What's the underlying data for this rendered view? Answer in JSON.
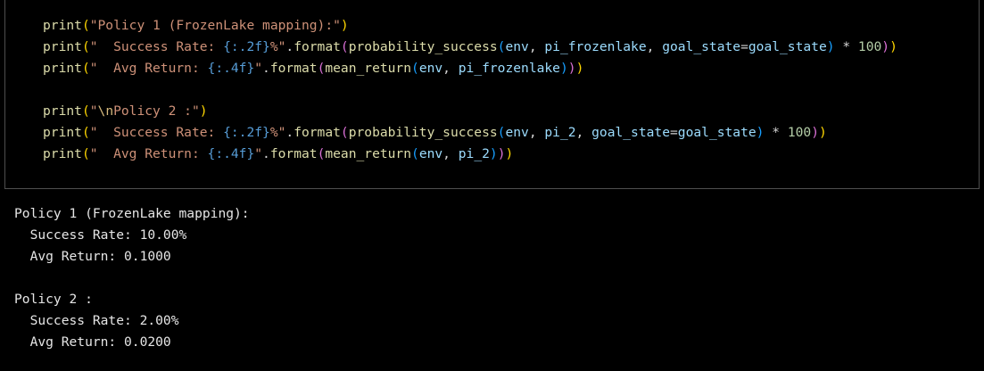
{
  "code": {
    "lines": [
      {
        "tokens": [
          {
            "text": "print",
            "cls": "fn"
          },
          {
            "text": "(",
            "cls": "p1"
          },
          {
            "text": "\"Policy 1 (FrozenLake mapping):\"",
            "cls": "str"
          },
          {
            "text": ")",
            "cls": "p1"
          }
        ]
      },
      {
        "tokens": [
          {
            "text": "print",
            "cls": "fn"
          },
          {
            "text": "(",
            "cls": "p1"
          },
          {
            "text": "\"  Success Rate: ",
            "cls": "str"
          },
          {
            "text": "{:.2f}",
            "cls": "fmt"
          },
          {
            "text": "%\"",
            "cls": "str"
          },
          {
            "text": ".",
            "cls": "op"
          },
          {
            "text": "format",
            "cls": "fn"
          },
          {
            "text": "(",
            "cls": "p2"
          },
          {
            "text": "probability_success",
            "cls": "fn"
          },
          {
            "text": "(",
            "cls": "p3"
          },
          {
            "text": "env",
            "cls": "var"
          },
          {
            "text": ", ",
            "cls": "op"
          },
          {
            "text": "pi_frozenlake",
            "cls": "var"
          },
          {
            "text": ", ",
            "cls": "op"
          },
          {
            "text": "goal_state",
            "cls": "var"
          },
          {
            "text": "=",
            "cls": "op"
          },
          {
            "text": "goal_state",
            "cls": "var"
          },
          {
            "text": ")",
            "cls": "p3"
          },
          {
            "text": " * ",
            "cls": "op"
          },
          {
            "text": "100",
            "cls": "num"
          },
          {
            "text": ")",
            "cls": "p2"
          },
          {
            "text": ")",
            "cls": "p1"
          }
        ]
      },
      {
        "tokens": [
          {
            "text": "print",
            "cls": "fn"
          },
          {
            "text": "(",
            "cls": "p1"
          },
          {
            "text": "\"  Avg Return: ",
            "cls": "str"
          },
          {
            "text": "{:.4f}",
            "cls": "fmt"
          },
          {
            "text": "\"",
            "cls": "str"
          },
          {
            "text": ".",
            "cls": "op"
          },
          {
            "text": "format",
            "cls": "fn"
          },
          {
            "text": "(",
            "cls": "p2"
          },
          {
            "text": "mean_return",
            "cls": "fn"
          },
          {
            "text": "(",
            "cls": "p3"
          },
          {
            "text": "env",
            "cls": "var"
          },
          {
            "text": ", ",
            "cls": "op"
          },
          {
            "text": "pi_frozenlake",
            "cls": "var"
          },
          {
            "text": ")",
            "cls": "p3"
          },
          {
            "text": ")",
            "cls": "p2"
          },
          {
            "text": ")",
            "cls": "p1"
          }
        ]
      },
      {
        "tokens": []
      },
      {
        "tokens": [
          {
            "text": "print",
            "cls": "fn"
          },
          {
            "text": "(",
            "cls": "p1"
          },
          {
            "text": "\"",
            "cls": "str"
          },
          {
            "text": "\\n",
            "cls": "esc"
          },
          {
            "text": "Policy 2 :\"",
            "cls": "str"
          },
          {
            "text": ")",
            "cls": "p1"
          }
        ]
      },
      {
        "tokens": [
          {
            "text": "print",
            "cls": "fn"
          },
          {
            "text": "(",
            "cls": "p1"
          },
          {
            "text": "\"  Success Rate: ",
            "cls": "str"
          },
          {
            "text": "{:.2f}",
            "cls": "fmt"
          },
          {
            "text": "%\"",
            "cls": "str"
          },
          {
            "text": ".",
            "cls": "op"
          },
          {
            "text": "format",
            "cls": "fn"
          },
          {
            "text": "(",
            "cls": "p2"
          },
          {
            "text": "probability_success",
            "cls": "fn"
          },
          {
            "text": "(",
            "cls": "p3"
          },
          {
            "text": "env",
            "cls": "var"
          },
          {
            "text": ", ",
            "cls": "op"
          },
          {
            "text": "pi_2",
            "cls": "var"
          },
          {
            "text": ", ",
            "cls": "op"
          },
          {
            "text": "goal_state",
            "cls": "var"
          },
          {
            "text": "=",
            "cls": "op"
          },
          {
            "text": "goal_state",
            "cls": "var"
          },
          {
            "text": ")",
            "cls": "p3"
          },
          {
            "text": " * ",
            "cls": "op"
          },
          {
            "text": "100",
            "cls": "num"
          },
          {
            "text": ")",
            "cls": "p2"
          },
          {
            "text": ")",
            "cls": "p1"
          }
        ]
      },
      {
        "tokens": [
          {
            "text": "print",
            "cls": "fn"
          },
          {
            "text": "(",
            "cls": "p1"
          },
          {
            "text": "\"  Avg Return: ",
            "cls": "str"
          },
          {
            "text": "{:.4f}",
            "cls": "fmt"
          },
          {
            "text": "\"",
            "cls": "str"
          },
          {
            "text": ".",
            "cls": "op"
          },
          {
            "text": "format",
            "cls": "fn"
          },
          {
            "text": "(",
            "cls": "p2"
          },
          {
            "text": "mean_return",
            "cls": "fn"
          },
          {
            "text": "(",
            "cls": "p3"
          },
          {
            "text": "env",
            "cls": "var"
          },
          {
            "text": ", ",
            "cls": "op"
          },
          {
            "text": "pi_2",
            "cls": "var"
          },
          {
            "text": ")",
            "cls": "p3"
          },
          {
            "text": ")",
            "cls": "p2"
          },
          {
            "text": ")",
            "cls": "p1"
          }
        ]
      }
    ]
  },
  "output": {
    "lines": [
      "Policy 1 (FrozenLake mapping):",
      "  Success Rate: 10.00%",
      "  Avg Return: 0.1000",
      "",
      "Policy 2 :",
      "  Success Rate: 2.00%",
      "  Avg Return: 0.0200"
    ]
  }
}
